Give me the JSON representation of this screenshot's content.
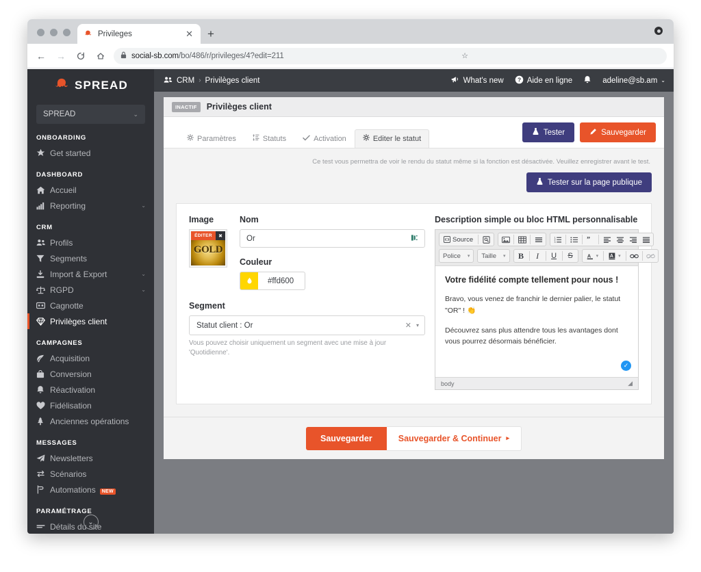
{
  "browser": {
    "tab": {
      "title": "Privileges",
      "favicon_icon": "octopus-favicon",
      "close_icon": "✕"
    },
    "newtab_label": "+",
    "nav": {
      "back": "←",
      "forward": "→",
      "reload": "C",
      "home": "⌂"
    },
    "url": {
      "lock_icon": "🔒",
      "domain": "social-sb.com",
      "path": "/bo/486/r/privileges/4?edit=211",
      "star_icon": "☆"
    },
    "window_menu_icon": "window-menu-icon"
  },
  "sidebar": {
    "brand": {
      "logo_icon": "octopus-logo",
      "name": "SPREAD"
    },
    "account_select": {
      "value": "SPREAD",
      "chevron": "⌄"
    },
    "groups": [
      {
        "title": "ONBOARDING",
        "items": [
          {
            "icon": "★",
            "label": "Get started",
            "chevron": ""
          }
        ]
      },
      {
        "title": "DASHBOARD",
        "items": [
          {
            "icon": "⌂",
            "label": "Accueil",
            "chevron": ""
          },
          {
            "icon": "▮▮▮",
            "label": "Reporting",
            "chevron": "⌄"
          }
        ]
      },
      {
        "title": "CRM",
        "items": [
          {
            "icon": "👥",
            "label": "Profils",
            "chevron": ""
          },
          {
            "icon": "▼",
            "label": "Segments",
            "chevron": ""
          },
          {
            "icon": "⤓",
            "label": "Import & Export",
            "chevron": "⌄"
          },
          {
            "icon": "⚖",
            "label": "RGPD",
            "chevron": "⌄"
          },
          {
            "icon": "▣",
            "label": "Cagnotte",
            "chevron": ""
          },
          {
            "icon": "◈",
            "label": "Privilèges client",
            "chevron": ""
          }
        ]
      },
      {
        "title": "CAMPAGNES",
        "items": [
          {
            "icon": "◤",
            "label": "Acquisition",
            "chevron": ""
          },
          {
            "icon": "▤",
            "label": "Conversion",
            "chevron": ""
          },
          {
            "icon": "🔔",
            "label": "Réactivation",
            "chevron": ""
          },
          {
            "icon": "♥",
            "label": "Fidélisation",
            "chevron": ""
          },
          {
            "icon": "⚘",
            "label": "Anciennes opérations",
            "chevron": ""
          }
        ]
      },
      {
        "title": "MESSAGES",
        "items": [
          {
            "icon": "➤",
            "label": "Newsletters",
            "chevron": ""
          },
          {
            "icon": "⇄",
            "label": "Scénarios",
            "chevron": ""
          },
          {
            "icon": "⑂",
            "label": "Automations",
            "chevron": "",
            "badge": "NEW"
          }
        ]
      },
      {
        "title": "PARAMÉTRAGE",
        "items": [
          {
            "icon": "▬",
            "label": "Détails du site",
            "chevron": ""
          }
        ]
      }
    ],
    "collapse_icon": "⌄"
  },
  "topbar": {
    "breadcrumb": {
      "icon": "👥",
      "root": "CRM",
      "separator": "›",
      "current": "Privilèges client"
    },
    "right": {
      "whats_new": {
        "icon": "📢",
        "label": "What's new"
      },
      "help": {
        "icon": "?",
        "label": "Aide en ligne"
      },
      "bell_icon": "🔔",
      "user": {
        "label": "adeline@sb.am",
        "chevron": "⌄"
      }
    }
  },
  "page": {
    "status_badge": "INACTIF",
    "title": "Privilèges client",
    "tabs": [
      {
        "icon": "⚙",
        "label": "Paramètres",
        "active": false
      },
      {
        "icon": "⇅",
        "label": "Statuts",
        "active": false
      },
      {
        "icon": "✔",
        "label": "Activation",
        "active": false
      },
      {
        "icon": "⚙",
        "label": "Editer le statut",
        "active": true
      }
    ],
    "actions": {
      "test": {
        "icon": "⚗",
        "label": "Tester",
        "color": "#3f3d7e"
      },
      "save": {
        "icon": "✎",
        "label": "Sauvegarder",
        "color": "#e8542a"
      }
    },
    "test_note": "Ce test vous permettra de voir le rendu du statut même si la fonction est désactivée. Veuillez enregistrer avant le test.",
    "test_public_button": {
      "icon": "⚗",
      "label": "Tester sur la page publique"
    }
  },
  "form": {
    "image": {
      "label": "Image",
      "edit_overlay": "ÉDITER",
      "remove_icon": "✖",
      "thumb_text": "GOLD"
    },
    "nom": {
      "label": "Nom",
      "value": "Or",
      "placeholder": "Nom",
      "trailing_icon": "translate-icon"
    },
    "couleur": {
      "label": "Couleur",
      "value": "#ffd600",
      "swatch_icon": "💧",
      "swatch_color": "#ffd600"
    },
    "segment": {
      "label": "Segment",
      "value": "Statut client : Or",
      "clear_icon": "✕",
      "chevron_icon": "▾",
      "help": "Vous pouvez choisir uniquement un segment avec une mise à jour 'Quotidienne'."
    }
  },
  "editor": {
    "title": "Description simple ou bloc HTML personnalisable",
    "toolbar_row1": [
      {
        "group": [
          {
            "name": "source-button",
            "icon": "◧",
            "label": "Source"
          },
          {
            "name": "preview-button",
            "icon": "🔍",
            "label": ""
          }
        ]
      },
      {
        "group": [
          {
            "name": "image-button",
            "icon": "🖼",
            "label": ""
          },
          {
            "name": "table-button",
            "icon": "▦",
            "label": ""
          },
          {
            "name": "horizontal-rule-button",
            "icon": "▬",
            "label": ""
          }
        ]
      },
      {
        "group": [
          {
            "name": "numbered-list-button",
            "icon": "⒈",
            "label": ""
          },
          {
            "name": "bulleted-list-button",
            "icon": "☰",
            "label": ""
          },
          {
            "name": "blockquote-button",
            "icon": "❞",
            "label": ""
          },
          {
            "name": "align-left-button",
            "icon": "▤",
            "label": ""
          },
          {
            "name": "align-center-button",
            "icon": "▤",
            "label": ""
          },
          {
            "name": "align-right-button",
            "icon": "▤",
            "label": ""
          },
          {
            "name": "align-justify-button",
            "icon": "▤",
            "label": ""
          }
        ]
      }
    ],
    "font_dropdown": {
      "label": "Police",
      "arrow": "▾"
    },
    "size_dropdown": {
      "label": "Taille",
      "arrow": "▾"
    },
    "bold_label": "B",
    "italic_label": "I",
    "underline_label": "U",
    "strike_label": "S",
    "text_color": {
      "icon": "A",
      "arrow": "▾"
    },
    "bg_color": {
      "icon": "A",
      "arrow": "▾"
    },
    "link_icon": "🔗",
    "unlink_icon": "🔗",
    "content": {
      "heading": "Votre fidélité compte tellement pour nous !",
      "paragraph1": "Bravo, vous venez de franchir le dernier palier, le statut \"OR\" ! 👏",
      "paragraph2": "Découvrez sans plus attendre tous les avantages dont vous pourrez désormais bénéficier."
    },
    "check_icon": "✓",
    "path_label": "body",
    "resize_icon": "◢"
  },
  "footer": {
    "save_label": "Sauvegarder",
    "save_continue_label": "Sauvegarder & Continuer",
    "save_continue_arrow": "▸"
  }
}
